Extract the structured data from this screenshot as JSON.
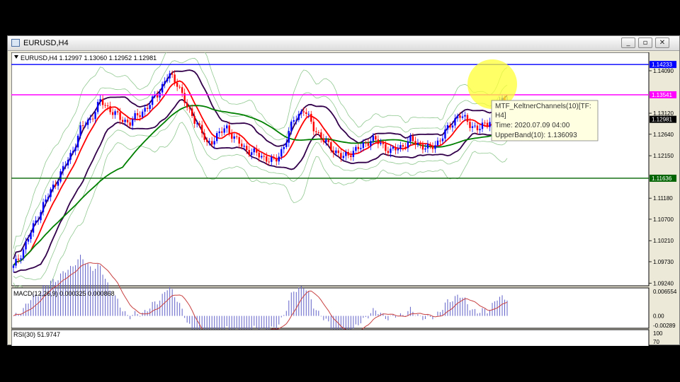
{
  "window": {
    "title": "EURUSD,H4",
    "buttons": [
      "minimize",
      "maximize",
      "close"
    ]
  },
  "chart_data": [
    {
      "type": "candlestick",
      "panel": "main",
      "header": "EURUSD,H4  1.12997 1.13060 1.12952 1.12981",
      "ylim": [
        1.0918,
        1.1451
      ],
      "yticks": [
        "1.14090",
        "1.13120",
        "1.12640",
        "1.12150",
        "1.11180",
        "1.10700",
        "1.10210",
        "1.09730",
        "1.09240"
      ],
      "horizontal_lines": [
        {
          "value": 1.14233,
          "label": "1.14233",
          "color": "#0000ff"
        },
        {
          "value": 1.13541,
          "label": "1.13541",
          "color": "#ff00ff"
        },
        {
          "value": 1.11636,
          "label": "1.11636",
          "color": "#006400"
        }
      ],
      "current_price": {
        "value": 1.12981,
        "label": "1.12981"
      },
      "close_path": [
        1.096,
        1.1,
        1.105,
        1.11,
        1.114,
        1.118,
        1.122,
        1.128,
        1.13,
        1.134,
        1.132,
        1.13,
        1.129,
        1.131,
        1.133,
        1.136,
        1.14,
        1.138,
        1.132,
        1.129,
        1.124,
        1.126,
        1.128,
        1.125,
        1.123,
        1.122,
        1.121,
        1.12,
        1.124,
        1.13,
        1.132,
        1.128,
        1.125,
        1.123,
        1.121,
        1.1225,
        1.1235,
        1.1255,
        1.124,
        1.1225,
        1.1235,
        1.125,
        1.124,
        1.123,
        1.125,
        1.128,
        1.131,
        1.129,
        1.1275,
        1.129,
        1.133,
        1.135
      ],
      "colors": {
        "up": "#0000ff",
        "down": "#ff0000",
        "ma_fast": "#ff0000",
        "ma_slow": "#008000",
        "keltner_mid": "#32004b",
        "keltner_outer": "#90c890",
        "background": "#ffffff"
      },
      "highlight_circle_color": "#ffff33",
      "tooltip": [
        "MTF_KeltnerChannels(10)[TF:",
        "H4]",
        "Time: 2020.07.09 04:00",
        "UpperBand(10): 1.136093"
      ]
    },
    {
      "type": "histogram",
      "panel": "macd",
      "header": "MACD(12,26,9) 0.000325 0.000868",
      "yticks": [
        "0.006554",
        "0.00",
        "-0.00289"
      ],
      "ylim": [
        -0.00289,
        0.006554
      ],
      "colors": {
        "bars": "#6060c8",
        "signal": "#c84040"
      }
    },
    {
      "type": "line",
      "panel": "rsi",
      "header": "RSI(30) 51.9747",
      "yticks": [
        "100",
        "70"
      ]
    }
  ]
}
